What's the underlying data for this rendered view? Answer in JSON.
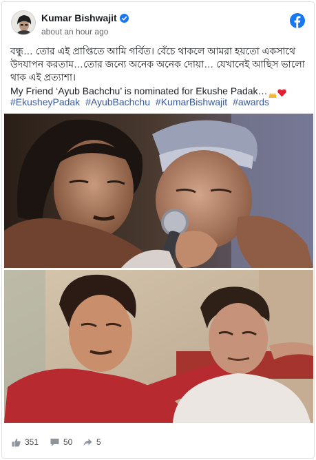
{
  "post": {
    "author": "Kumar Bishwajit",
    "timestamp": "about an hour ago",
    "text_line1": "বন্ধু… তোর এই প্রাপ্তিতে আমি গর্বিত। বেঁচে থাকলে আমরা হয়তো একসাথে",
    "text_line2": "উদযাপন করতাম…তোর জন্যে অনেক অনেক দোয়া… যেখানেই আছিস ভালো",
    "text_line3": "থাক এই প্রত্যাশা।",
    "text_line4": "My Friend ‘Ayub Bachchu’ is nominated for Ekushe Padak…",
    "hashtags": [
      "#EkusheyPadak",
      "#AyubBachchu",
      "#KumarBishwajit",
      "#awards"
    ]
  },
  "stats": {
    "likes": "351",
    "comments": "50",
    "shares": "5"
  },
  "icons": {
    "verified": "verified-badge-icon",
    "brand": "facebook-logo-icon",
    "like": "thumbs-up-icon",
    "comment": "comment-icon",
    "share": "share-arrow-icon",
    "emoji1": "raising-hands-emoji",
    "emoji2": "red-heart-emoji"
  },
  "colors": {
    "facebook_blue": "#1877f2",
    "hashtag_link": "#385898",
    "heart_red": "#e02033"
  }
}
